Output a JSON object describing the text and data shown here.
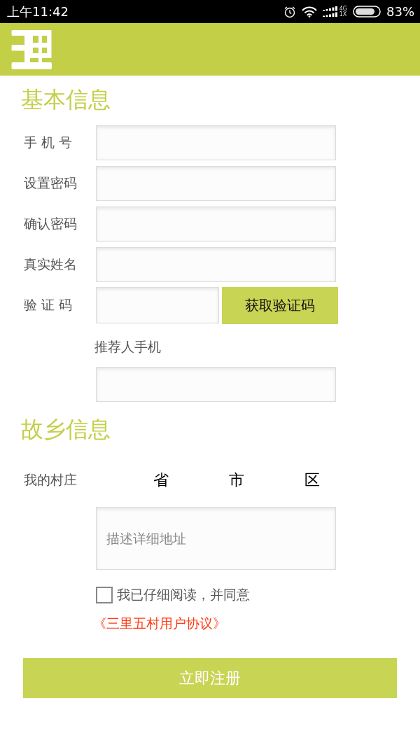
{
  "status_bar": {
    "time": "上午11:42",
    "network": [
      "4G",
      "1X"
    ],
    "battery": "83%"
  },
  "basic_info": {
    "title": "基本信息",
    "fields": [
      {
        "kind": "input",
        "label": "手 机 号"
      },
      {
        "kind": "input",
        "label": "设置密码"
      },
      {
        "kind": "input",
        "label": "确认密码"
      },
      {
        "kind": "input",
        "label": "真实姓名"
      },
      {
        "kind": "input_with_button",
        "label": "验 证 码",
        "button": "获取验证码"
      }
    ],
    "referrer": {
      "label": "推荐人手机"
    }
  },
  "hometown": {
    "title": "故乡信息",
    "village": {
      "label": "我的村庄",
      "pickers": [
        "省",
        "市",
        "区"
      ]
    },
    "address": {
      "placeholder": "描述详细地址"
    }
  },
  "agreement": {
    "checked": false,
    "text": "我已仔细阅读，并同意",
    "link": "《三里五村用户协议》"
  },
  "submit_button": "立即注册"
}
